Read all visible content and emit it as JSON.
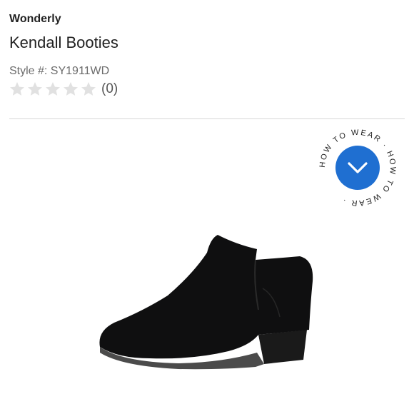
{
  "product": {
    "brand": "Wonderly",
    "name": "Kendall Booties",
    "style_label": "Style #: SY1911WD",
    "rating": {
      "stars_filled": 0,
      "stars_total": 5,
      "count_label": "(0)"
    }
  },
  "how_to_wear": {
    "ring_text": "HOW TO WEAR · HOW TO WEAR ·",
    "icon": "chevron-down-icon",
    "accent_color": "#1f6fd1"
  },
  "image": {
    "subject": "black suede ankle bootie"
  }
}
